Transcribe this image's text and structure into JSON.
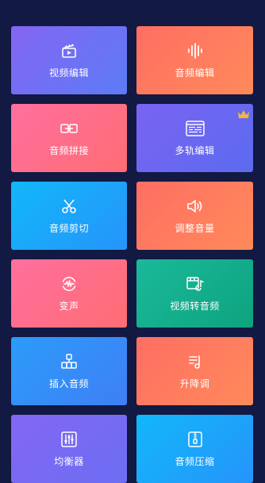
{
  "tiles": [
    {
      "label": "视频编辑",
      "icon": "clapperboard-icon",
      "gradient": [
        "#8466f3",
        "#5c7bf5"
      ]
    },
    {
      "label": "音频编辑",
      "icon": "waveform-icon",
      "gradient": [
        "#ff6e63",
        "#ff8a5a"
      ]
    },
    {
      "label": "音频拼接",
      "icon": "splice-icon",
      "gradient": [
        "#ff6f9e",
        "#ff6d73"
      ]
    },
    {
      "label": "多轨编辑",
      "icon": "multitrack-icon",
      "gradient": [
        "#7a63f2",
        "#5b6bf0"
      ],
      "badge": "crown-icon",
      "badge_color": "#f4b63b"
    },
    {
      "label": "音频剪切",
      "icon": "scissors-icon",
      "gradient": [
        "#12b7f9",
        "#2694fb"
      ]
    },
    {
      "label": "调整音量",
      "icon": "speaker-icon",
      "gradient": [
        "#ff6e63",
        "#ff8a5a"
      ]
    },
    {
      "label": "变声",
      "icon": "voice-change-icon",
      "gradient": [
        "#ff6f9e",
        "#ff6d73"
      ]
    },
    {
      "label": "视频转音频",
      "icon": "video-to-audio-icon",
      "gradient": [
        "#1ab99a",
        "#0ea37f"
      ]
    },
    {
      "label": "插入音频",
      "icon": "insert-audio-icon",
      "gradient": [
        "#2b9cf9",
        "#3f7ff6"
      ]
    },
    {
      "label": "升降调",
      "icon": "pitch-icon",
      "gradient": [
        "#ff6e63",
        "#ff8a5a"
      ]
    },
    {
      "label": "均衡器",
      "icon": "equalizer-icon",
      "gradient": [
        "#8466f3",
        "#6b6ef3"
      ]
    },
    {
      "label": "音频压缩",
      "icon": "zip-icon",
      "gradient": [
        "#12b7f9",
        "#2694fb"
      ]
    }
  ]
}
